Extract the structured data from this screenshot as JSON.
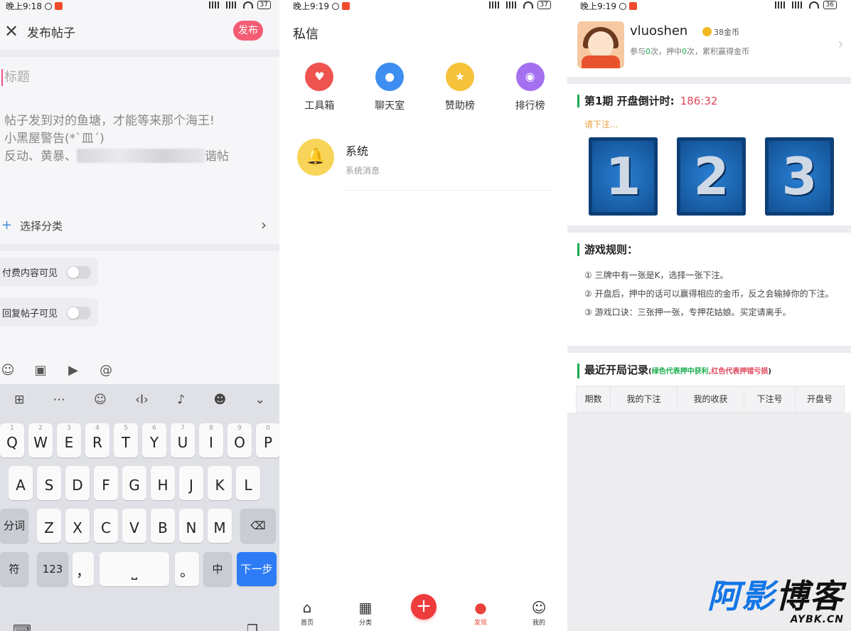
{
  "panel1": {
    "status_time": "晚上9:18",
    "battery": "37",
    "title": "发布帖子",
    "publish_label": "发布",
    "title_placeholder": "标题",
    "body_line1": "帖子发到对的鱼塘，才能等来那个海王!",
    "body_line2": "小黑屋警告(*`皿´)",
    "body_line3_start": "反动、黄暴、",
    "body_line3_end": "谐帖",
    "category_label": "选择分类",
    "toggle_paid": "付费内容可见",
    "toggle_reply": "回复帖子可见",
    "keyboard": {
      "row1": [
        "Q",
        "W",
        "E",
        "R",
        "T",
        "Y",
        "U",
        "I",
        "O",
        "P"
      ],
      "row1_sub": [
        "1",
        "2",
        "3",
        "4",
        "5",
        "6",
        "7",
        "8",
        "9",
        "0"
      ],
      "row2": [
        "A",
        "S",
        "D",
        "F",
        "G",
        "H",
        "J",
        "K",
        "L"
      ],
      "row3": [
        "Z",
        "X",
        "C",
        "V",
        "B",
        "N",
        "M"
      ],
      "seg_label": "分词",
      "sym_label": "符",
      "num_label": "123",
      "comma": "，",
      "period": "。",
      "lang_label": "中",
      "next_label": "下一步"
    }
  },
  "panel2": {
    "status_time": "晚上9:19",
    "battery": "37",
    "title": "私信",
    "grid": [
      {
        "label": "工具箱",
        "color": "#ef5350",
        "icon": "heart-icon",
        "glyph": "♥"
      },
      {
        "label": "聊天室",
        "color": "#3d8ef0",
        "icon": "chat-icon",
        "glyph": "●"
      },
      {
        "label": "赞助榜",
        "color": "#f6c23a",
        "icon": "star-icon",
        "glyph": "★"
      },
      {
        "label": "排行榜",
        "color": "#a470f0",
        "icon": "rank-icon",
        "glyph": "◉"
      }
    ],
    "msg_name": "系统",
    "msg_sub": "系统消息",
    "tabs": [
      {
        "label": "首页",
        "icon": "home-icon",
        "glyph": "⌂"
      },
      {
        "label": "分类",
        "icon": "grid-icon",
        "glyph": "▦"
      },
      {
        "label": "发现",
        "icon": "discover-icon",
        "glyph": "●"
      },
      {
        "label": "我的",
        "icon": "profile-icon",
        "glyph": "☺"
      }
    ],
    "fab_glyph": "+"
  },
  "panel3": {
    "status_time": "晚上9:19",
    "battery": "36",
    "username": "vluoshen",
    "coins": "38金币",
    "stats_a": "参与",
    "stats_join": "0",
    "stats_b": "次，押中",
    "stats_hit": "0",
    "stats_c": "次，累积赢得金币",
    "round_title": "第1期  开盘倒计时:",
    "countdown": "186:32",
    "please_bet": "请下注...",
    "cards": [
      "1",
      "2",
      "3"
    ],
    "rules_title": "游戏规则：",
    "rules": [
      "① 三牌中有一张是K，选择一张下注。",
      "② 开盘后，押中的话可以赢得相应的金币，反之会输掉你的下注。",
      "③ 游戏口诀：三张押一张，专押花姑娘。买定请离手。"
    ],
    "record_title": "最近开局记录",
    "record_paren_open": "(",
    "record_note_green": "绿色代表押中获利",
    "record_note_sep": ",",
    "record_note_red": "红色代表押错亏损",
    "record_paren_close": ")",
    "table_headers": [
      "期数",
      "我的下注",
      "我的收获",
      "下注号",
      "开盘号"
    ],
    "watermark_big_a": "阿影",
    "watermark_big_b": "博客",
    "watermark_small": "AYBK.CN"
  }
}
